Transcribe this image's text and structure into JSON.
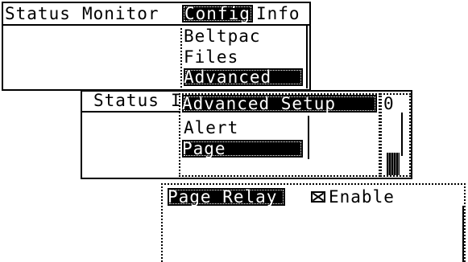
{
  "window1": {
    "menu": [
      "Status",
      "Monitor",
      "Config",
      "Info"
    ],
    "dropdown": [
      "Beltpac",
      "Files",
      "Advanced"
    ]
  },
  "window2": {
    "menu_partial": [
      "Status",
      "I"
    ],
    "submenu_title": "Advanced Setup",
    "submenu_items": [
      "Alert",
      "Page"
    ],
    "side_value": "0"
  },
  "window3": {
    "panel_title": "Page Relay",
    "checkbox_label": "Enable",
    "checkbox_checked": true
  }
}
